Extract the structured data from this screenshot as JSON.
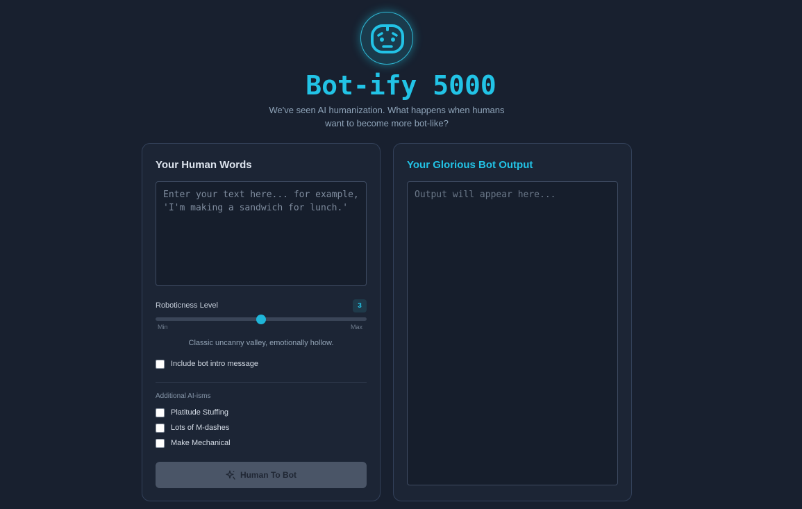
{
  "app": {
    "title": "Bot-ify 5000",
    "subtitle": "We've seen AI humanization. What happens when humans want to become more bot-like?",
    "logo_icon": "robot-face-icon",
    "accent_color": "#22c3e6"
  },
  "input_card": {
    "title": "Your Human Words",
    "textarea_placeholder": "Enter your text here... for example, 'I'm making a sandwich for lunch.'",
    "textarea_value": ""
  },
  "slider": {
    "label": "Roboticness Level",
    "value": 3,
    "min_value": 1,
    "max_value": 5,
    "min_label": "Min",
    "max_label": "Max",
    "description": "Classic uncanny valley, emotionally hollow."
  },
  "options": {
    "intro_message": {
      "label": "Include bot intro message",
      "checked": false
    },
    "section_label": "Additional AI-isms",
    "ai_isms": [
      {
        "label": "Platitude Stuffing",
        "checked": false
      },
      {
        "label": "Lots of M-dashes",
        "checked": false
      },
      {
        "label": "Make Mechanical",
        "checked": false
      }
    ]
  },
  "action_button": {
    "label": "Human To Bot",
    "icon": "sparkle-icon"
  },
  "output_card": {
    "title": "Your Glorious Bot Output",
    "placeholder": "Output will appear here..."
  }
}
